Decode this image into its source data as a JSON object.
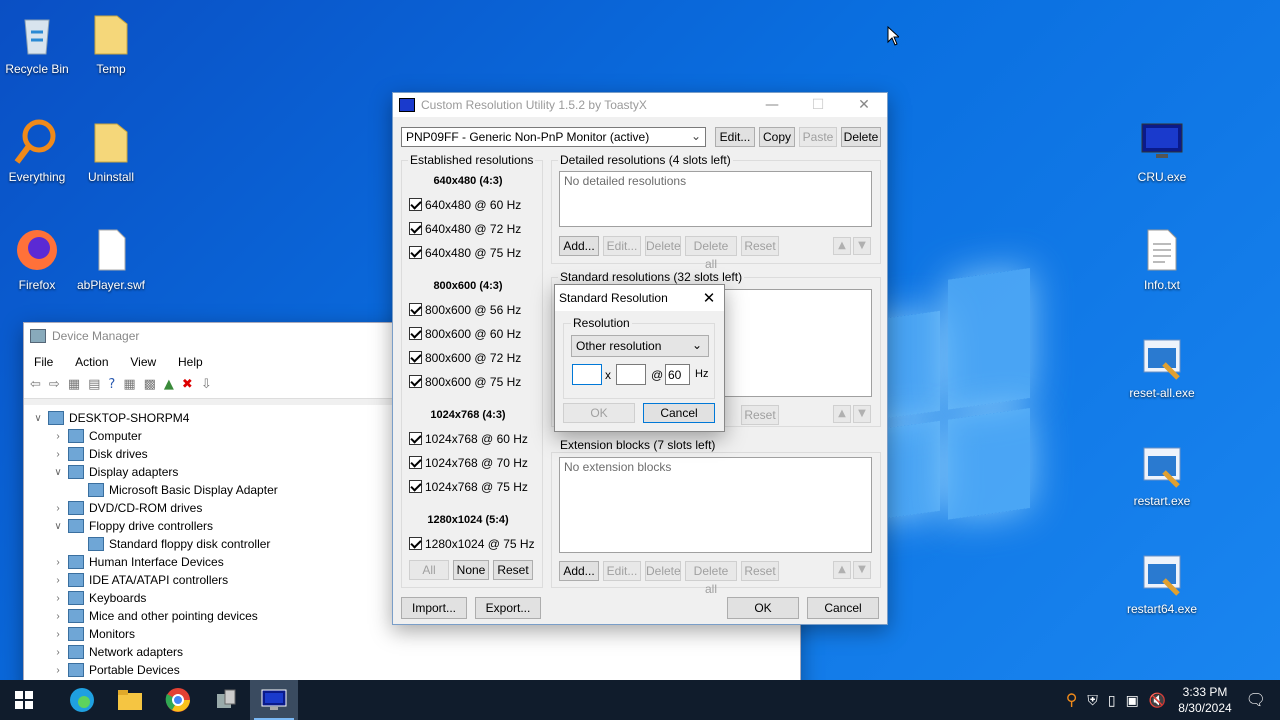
{
  "desktop": {
    "icons_left": [
      {
        "label": "Recycle Bin"
      },
      {
        "label": "Temp"
      },
      {
        "label": "Everything"
      },
      {
        "label": "Uninstall"
      },
      {
        "label": "Firefox"
      },
      {
        "label": "abPlayer.swf"
      }
    ],
    "icons_right": [
      {
        "label": "CRU.exe"
      },
      {
        "label": "Info.txt"
      },
      {
        "label": "reset-all.exe"
      },
      {
        "label": "restart.exe"
      },
      {
        "label": "restart64.exe"
      }
    ]
  },
  "cru": {
    "title": "Custom Resolution Utility 1.5.2 by ToastyX",
    "monitor_select": "PNP09FF - Generic Non-PnP Monitor (active)",
    "top_buttons": {
      "edit": "Edit...",
      "copy": "Copy",
      "paste": "Paste",
      "delete": "Delete"
    },
    "established": {
      "title": "Established resolutions",
      "groups": [
        {
          "head": "640x480 (4:3)",
          "items": [
            "640x480 @ 60 Hz",
            "640x480 @ 72 Hz",
            "640x480 @ 75 Hz"
          ]
        },
        {
          "head": "800x600 (4:3)",
          "items": [
            "800x600 @ 56 Hz",
            "800x600 @ 60 Hz",
            "800x600 @ 72 Hz",
            "800x600 @ 75 Hz"
          ]
        },
        {
          "head": "1024x768 (4:3)",
          "items": [
            "1024x768 @ 60 Hz",
            "1024x768 @ 70 Hz",
            "1024x768 @ 75 Hz"
          ]
        },
        {
          "head": "1280x1024 (5:4)",
          "items": [
            "1280x1024 @ 75 Hz"
          ]
        }
      ],
      "buttons": {
        "all": "All",
        "none": "None",
        "reset": "Reset"
      }
    },
    "detailed": {
      "title": "Detailed resolutions (4 slots left)",
      "empty": "No detailed resolutions",
      "buttons": {
        "add": "Add...",
        "edit": "Edit...",
        "delete": "Delete",
        "delete_all": "Delete all",
        "reset": "Reset"
      }
    },
    "standard": {
      "title": "Standard resolutions (32 slots left)",
      "reset": "Reset"
    },
    "extension": {
      "title": "Extension blocks (7 slots left)",
      "empty": "No extension blocks",
      "buttons": {
        "add": "Add...",
        "edit": "Edit...",
        "delete": "Delete",
        "delete_all": "Delete all",
        "reset": "Reset"
      }
    },
    "bottom": {
      "import": "Import...",
      "export": "Export...",
      "ok": "OK",
      "cancel": "Cancel"
    }
  },
  "dialog": {
    "title": "Standard Resolution",
    "group": "Resolution",
    "select": "Other resolution",
    "width": "",
    "x_sep": "x",
    "height": "",
    "at": "@",
    "refresh": "60",
    "hz": "Hz",
    "ok": "OK",
    "cancel": "Cancel"
  },
  "device_manager": {
    "title": "Device Manager",
    "menu": [
      "File",
      "Action",
      "View",
      "Help"
    ],
    "root": "DESKTOP-SHORPM4",
    "tree": [
      {
        "label": "Computer",
        "level": 1,
        "expanded": false
      },
      {
        "label": "Disk drives",
        "level": 1,
        "expanded": false
      },
      {
        "label": "Display adapters",
        "level": 1,
        "expanded": true
      },
      {
        "label": "Microsoft Basic Display Adapter",
        "level": 2
      },
      {
        "label": "DVD/CD-ROM drives",
        "level": 1,
        "expanded": false
      },
      {
        "label": "Floppy drive controllers",
        "level": 1,
        "expanded": true
      },
      {
        "label": "Standard floppy disk controller",
        "level": 2
      },
      {
        "label": "Human Interface Devices",
        "level": 1,
        "expanded": false
      },
      {
        "label": "IDE ATA/ATAPI controllers",
        "level": 1,
        "expanded": false
      },
      {
        "label": "Keyboards",
        "level": 1,
        "expanded": false
      },
      {
        "label": "Mice and other pointing devices",
        "level": 1,
        "expanded": false
      },
      {
        "label": "Monitors",
        "level": 1,
        "expanded": false
      },
      {
        "label": "Network adapters",
        "level": 1,
        "expanded": false
      },
      {
        "label": "Portable Devices",
        "level": 1,
        "expanded": false
      }
    ]
  },
  "taskbar": {
    "time": "3:33 PM",
    "date": "8/30/2024"
  },
  "colors": {
    "accent": "#0078d7",
    "taskbar": "#101c2c"
  }
}
